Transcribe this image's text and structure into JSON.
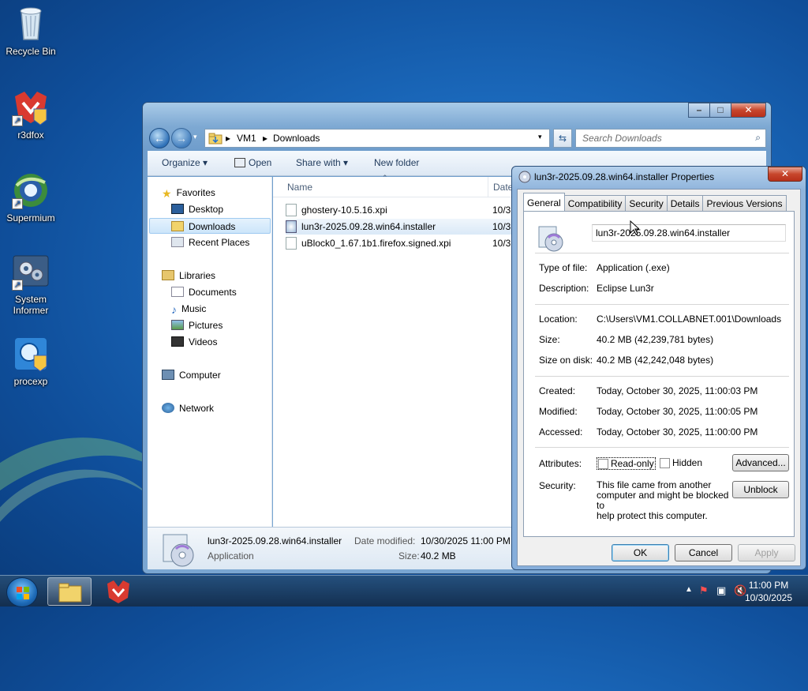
{
  "desktop": {
    "icons": [
      {
        "label": "Recycle Bin",
        "icon": "recycle-bin-icon"
      },
      {
        "label": "r3dfox",
        "icon": "r3dfox-icon"
      },
      {
        "label": "Supermium",
        "icon": "supermium-icon"
      },
      {
        "label": "System Informer",
        "icon": "system-informer-icon"
      },
      {
        "label": "procexp",
        "icon": "procexp-icon"
      }
    ]
  },
  "explorer": {
    "breadcrumb": [
      "VM1",
      "Downloads"
    ],
    "search_placeholder": "Search Downloads",
    "toolbar": {
      "organize": "Organize",
      "open": "Open",
      "share_with": "Share with",
      "new_folder": "New folder"
    },
    "nav": {
      "favorites": "Favorites",
      "desktop": "Desktop",
      "downloads": "Downloads",
      "recent_places": "Recent Places",
      "libraries": "Libraries",
      "documents": "Documents",
      "music": "Music",
      "pictures": "Pictures",
      "videos": "Videos",
      "computer": "Computer",
      "network": "Network"
    },
    "columns": {
      "name": "Name",
      "date": "Date"
    },
    "files": [
      {
        "name": "ghostery-10.5.16.xpi",
        "date": "10/3"
      },
      {
        "name": "lun3r-2025.09.28.win64.installer",
        "date": "10/3"
      },
      {
        "name": "uBlock0_1.67.1b1.firefox.signed.xpi",
        "date": "10/3"
      }
    ],
    "details": {
      "filename": "lun3r-2025.09.28.win64.installer",
      "type": "Application",
      "date_modified_label": "Date modified:",
      "date_modified": "10/30/2025 11:00 PM",
      "size_label": "Size:",
      "size": "40.2 MB"
    }
  },
  "dialog": {
    "title": "lun3r-2025.09.28.win64.installer Properties",
    "tabs": [
      "General",
      "Compatibility",
      "Security",
      "Details",
      "Previous Versions"
    ],
    "filename": "lun3r-2025.09.28.win64.installer",
    "labels": {
      "type": "Type of file:",
      "description": "Description:",
      "location": "Location:",
      "size": "Size:",
      "size_on_disk": "Size on disk:",
      "created": "Created:",
      "modified": "Modified:",
      "accessed": "Accessed:",
      "attributes": "Attributes:",
      "security": "Security:"
    },
    "values": {
      "type": "Application (.exe)",
      "description": "Eclipse Lun3r",
      "location": "C:\\Users\\VM1.COLLABNET.001\\Downloads",
      "size": "40.2 MB (42,239,781 bytes)",
      "size_on_disk": "40.2 MB (42,242,048 bytes)",
      "created": "Today, October 30, 2025, 11:00:03 PM",
      "modified": "Today, October 30, 2025, 11:00:05 PM",
      "accessed": "Today, October 30, 2025, 11:00:00 PM"
    },
    "attributes": {
      "readonly": "Read-only",
      "hidden": "Hidden",
      "advanced": "Advanced..."
    },
    "security_text": [
      "This file came from another",
      "computer and might be blocked to",
      "help protect this computer."
    ],
    "unblock": "Unblock",
    "buttons": {
      "ok": "OK",
      "cancel": "Cancel",
      "apply": "Apply"
    }
  },
  "taskbar": {
    "time": "11:00 PM",
    "date": "10/30/2025"
  }
}
